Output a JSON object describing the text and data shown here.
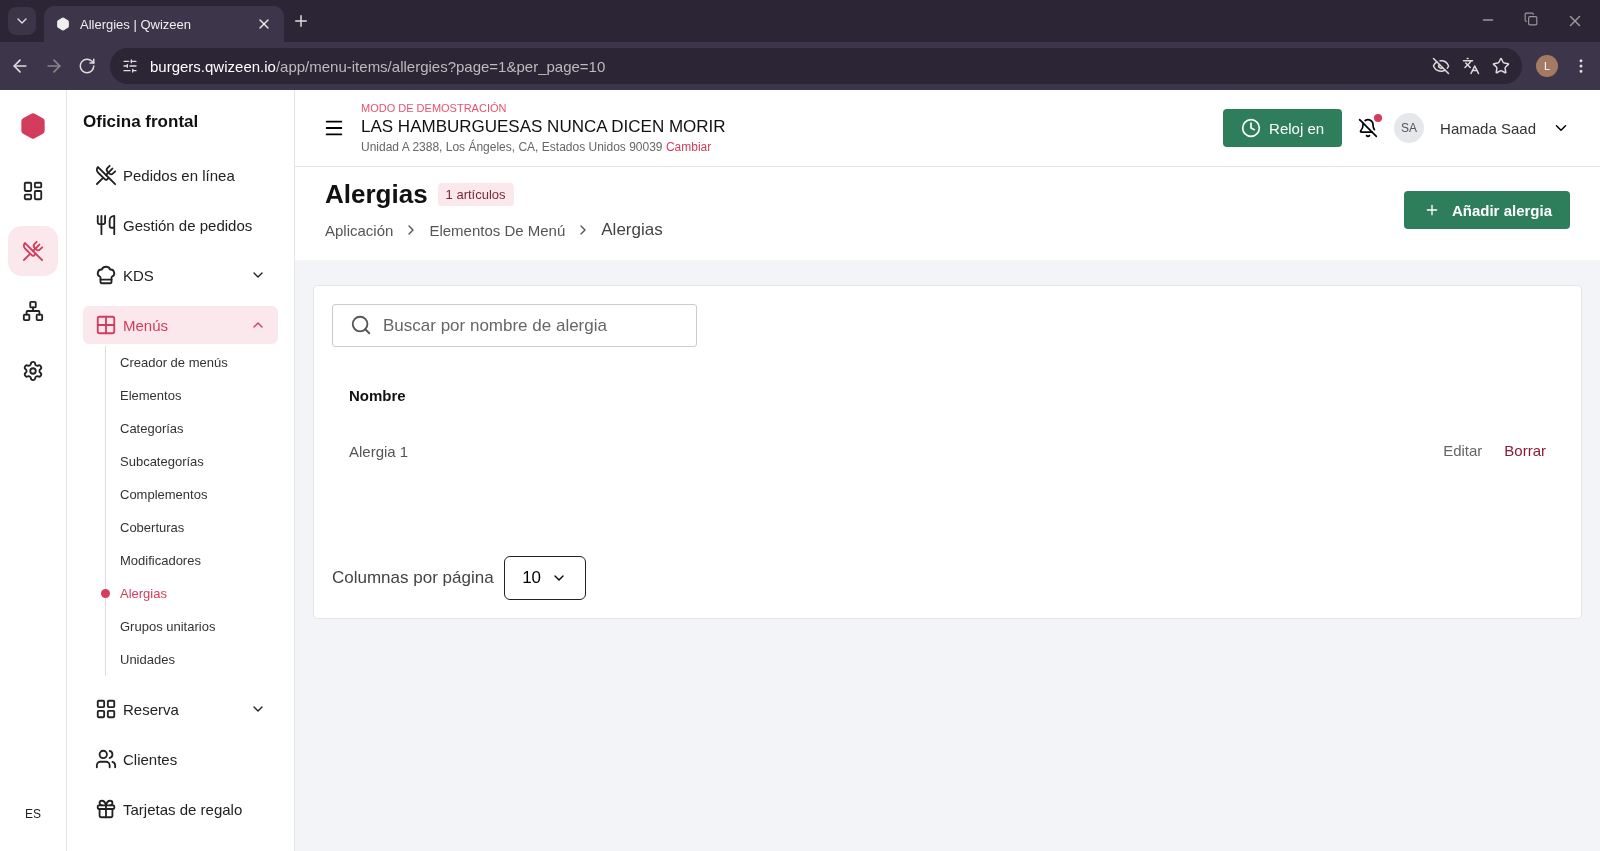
{
  "browser": {
    "tabs": [
      {
        "title": "Allergies | Qwizeen",
        "selected": true
      }
    ],
    "url": {
      "host": "burgers.qwizeen.io",
      "path": "/app/menu-items/allergies?page=1&per_page=10"
    },
    "profile": "L"
  },
  "rail": {
    "items": [
      {
        "kind": "dashboard",
        "selected": false
      },
      {
        "kind": "orders",
        "selected": true
      },
      {
        "kind": "org",
        "selected": false
      },
      {
        "kind": "settings",
        "selected": false
      }
    ],
    "language": "ES"
  },
  "sidebar": {
    "title": "Oficina frontal",
    "items": [
      {
        "label": "Pedidos en línea",
        "kind": "cutlery-cross",
        "selected": false
      },
      {
        "label": "Gestión de pedidos",
        "kind": "fork-knife",
        "selected": false
      },
      {
        "label": "KDS",
        "kind": "chef",
        "selected": false,
        "expanded": false
      },
      {
        "label": "Menús",
        "kind": "grid",
        "selected": true,
        "expanded": true,
        "children": [
          {
            "label": "Creador de menús",
            "selected": false
          },
          {
            "label": "Elementos",
            "selected": false
          },
          {
            "label": "Categorías",
            "selected": false
          },
          {
            "label": "Subcategorías",
            "selected": false
          },
          {
            "label": "Complementos",
            "selected": false
          },
          {
            "label": "Coberturas",
            "selected": false
          },
          {
            "label": "Modificadores",
            "selected": false
          },
          {
            "label": "Alergias",
            "selected": true
          },
          {
            "label": "Grupos unitarios",
            "selected": false
          },
          {
            "label": "Unidades",
            "selected": false
          }
        ]
      },
      {
        "label": "Reserva",
        "kind": "table",
        "selected": false,
        "expanded": false
      },
      {
        "label": "Clientes",
        "kind": "users",
        "selected": false
      },
      {
        "label": "Tarjetas de regalo",
        "kind": "gift",
        "selected": false
      }
    ]
  },
  "header": {
    "demo_label": "MODO DE DEMOSTRACIÓN",
    "restaurant": "LAS HAMBURGUESAS NUNCA DICEN MORIR",
    "address": "Unidad A 2388, Los Ángeles, CA, Estados Unidos 90039",
    "change_link": "Cambiar",
    "clock_button": "Reloj en",
    "user": {
      "initials": "SA",
      "name": "Hamada Saad"
    }
  },
  "page": {
    "title": "Alergias",
    "count_badge": "1 artículos",
    "breadcrumbs": [
      "Aplicación",
      "Elementos De Menú",
      "Alergias"
    ],
    "add_button": "Añadir alergia",
    "search": {
      "placeholder": "Buscar por nombre de alergia"
    },
    "table": {
      "columns": [
        "Nombre"
      ],
      "rows": [
        {
          "name": "Alergia 1",
          "actions": [
            {
              "label": "Editar",
              "kind": "edit"
            },
            {
              "label": "Borrar",
              "kind": "delete"
            }
          ]
        }
      ]
    },
    "pagination": {
      "label": "Columnas por página",
      "value": "10"
    }
  }
}
